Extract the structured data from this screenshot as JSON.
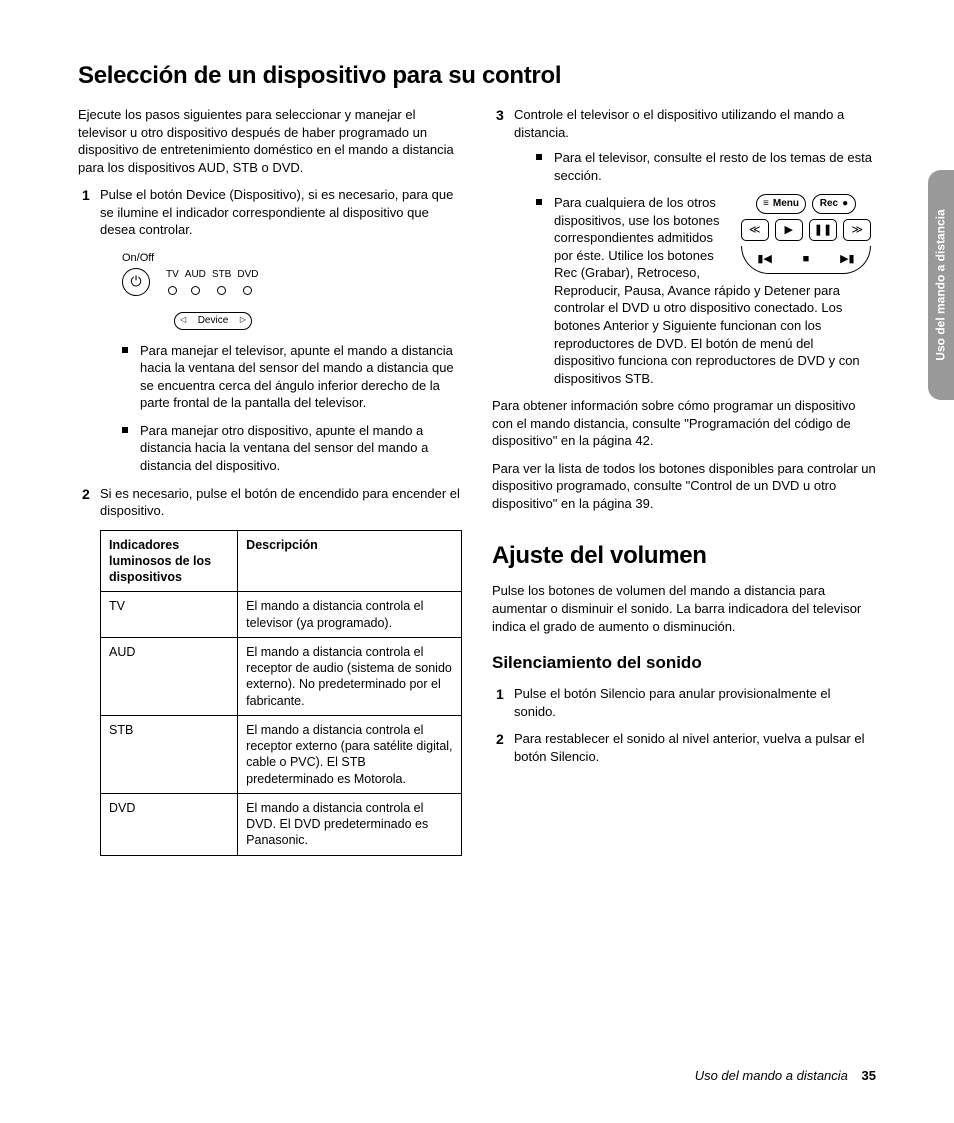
{
  "heading1": "Selección de un dispositivo para su control",
  "intro": "Ejecute los pasos siguientes para seleccionar y manejar el televisor u otro dispositivo después de haber programado un dispositivo de entretenimiento doméstico en el mando a distancia para los dispositivos AUD, STB o DVD.",
  "steps_left": {
    "s1": "Pulse el botón Device (Dispositivo), si es necesario, para que se ilumine el indicador correspondiente al dispositivo que desea controlar.",
    "s1_b1": "Para manejar el televisor, apunte el mando a distancia hacia la ventana del sensor del mando a distancia que se encuentra cerca del ángulo inferior derecho de la parte frontal de la pantalla del televisor.",
    "s1_b2": "Para manejar otro dispositivo, apunte el mando a distancia hacia la ventana del sensor del mando a distancia del dispositivo.",
    "s2": "Si es necesario, pulse el botón de encendido para encender el dispositivo."
  },
  "diagram": {
    "onoff": "On/Off",
    "leds": [
      "TV",
      "AUD",
      "STB",
      "DVD"
    ],
    "device": "Device"
  },
  "table": {
    "h1": "Indicadores luminosos de los dispositivos",
    "h2": "Descripción",
    "rows": [
      {
        "c1": "TV",
        "c2": "El mando a distancia controla el televisor (ya programado)."
      },
      {
        "c1": "AUD",
        "c2": "El mando a distancia controla el receptor de audio (sistema de sonido externo). No predeterminado por el fabricante."
      },
      {
        "c1": "STB",
        "c2": "El mando a distancia controla el receptor externo (para satélite digital, cable o PVC). El STB predeterminado es Motorola."
      },
      {
        "c1": "DVD",
        "c2": "El mando a distancia controla el DVD. El DVD predeterminado es Panasonic."
      }
    ]
  },
  "steps_right": {
    "s3": "Controle el televisor o el dispositivo utilizando el mando a distancia.",
    "s3_b1": "Para el televisor, consulte el resto de los temas de esta sección.",
    "s3_b2": "Para cualquiera de los otros dispositivos, use los botones correspondientes admitidos por éste. Utilice los botones Rec (Grabar), Retroceso, Reproducir, Pausa, Avance rápido y Detener para controlar el DVD u otro dispositivo conectado. Los botones Anterior y Siguiente funcionan con los reproductores de DVD. El botón de menú del dispositivo funciona con reproductores de DVD y con dispositivos STB."
  },
  "remote_buttons": {
    "menu": "Menu",
    "rec": "Rec"
  },
  "para_info": "Para obtener información sobre cómo programar un dispositivo con el mando distancia, consulte \"Programación del código de dispositivo\" en la página 42.",
  "para_list": "Para ver la lista de todos los botones disponibles para controlar un dispositivo programado, consulte \"Control de un DVD u otro dispositivo\" en la página 39.",
  "heading2": "Ajuste del volumen",
  "vol_intro": "Pulse los botones de volumen del mando a distancia para aumentar o disminuir el sonido. La barra indicadora del televisor indica el grado de aumento o disminución.",
  "heading3": "Silenciamiento del sonido",
  "mute_steps": {
    "s1": "Pulse el botón Silencio para anular provisionalmente el sonido.",
    "s2": "Para restablecer el sonido al nivel anterior, vuelva a pulsar el botón Silencio."
  },
  "side_tab": "Uso del mando a distancia",
  "footer_title": "Uso del mando a distancia",
  "footer_page": "35"
}
